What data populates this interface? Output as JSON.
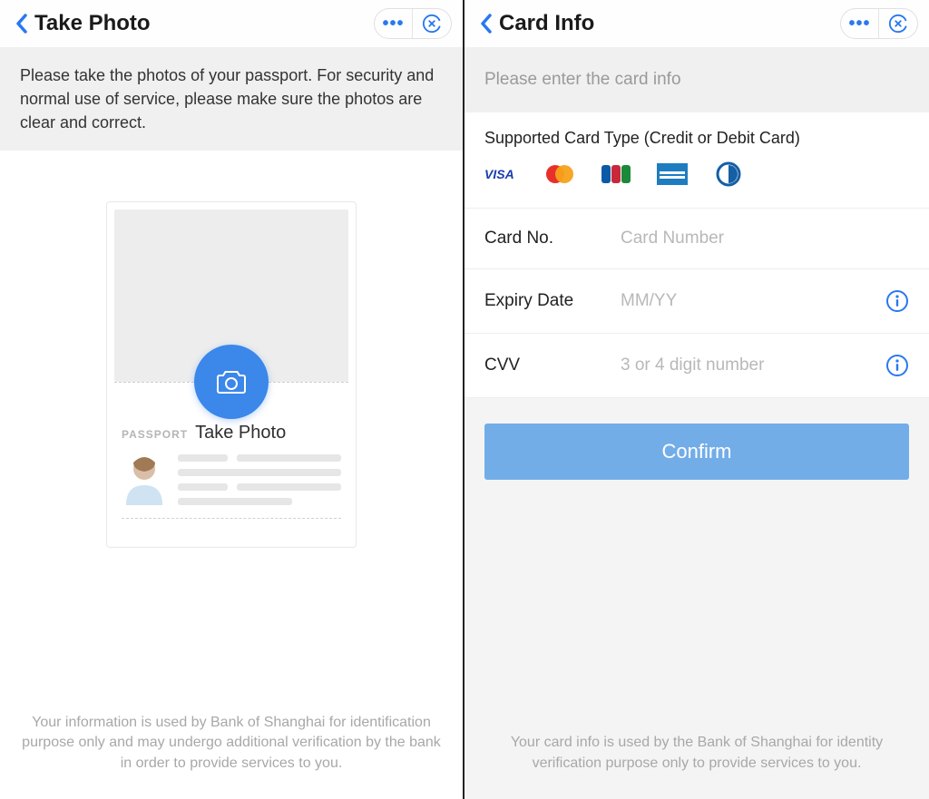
{
  "left": {
    "title": "Take Photo",
    "banner": "Please take the photos of your passport. For security and normal use of service, please make sure the photos are clear and correct.",
    "passport_tag": "PASSPORT",
    "take_photo_label": "Take Photo",
    "footer": "Your information is used by Bank of Shanghai for identification purpose only and may undergo additional verification by the bank in order to provide services to you."
  },
  "right": {
    "title": "Card Info",
    "banner": "Please enter the card info",
    "supported_label": "Supported Card Type (Credit or Debit Card)",
    "card_types": [
      "VISA",
      "Mastercard",
      "JCB",
      "American Express",
      "Diners Club"
    ],
    "fields": {
      "card_no": {
        "label": "Card No.",
        "placeholder": "Card Number"
      },
      "expiry": {
        "label": "Expiry Date",
        "placeholder": "MM/YY"
      },
      "cvv": {
        "label": "CVV",
        "placeholder": "3 or 4 digit number"
      }
    },
    "confirm_label": "Confirm",
    "footer": "Your card info is used by the Bank of Shanghai for identity verification purpose only to provide services to you."
  }
}
